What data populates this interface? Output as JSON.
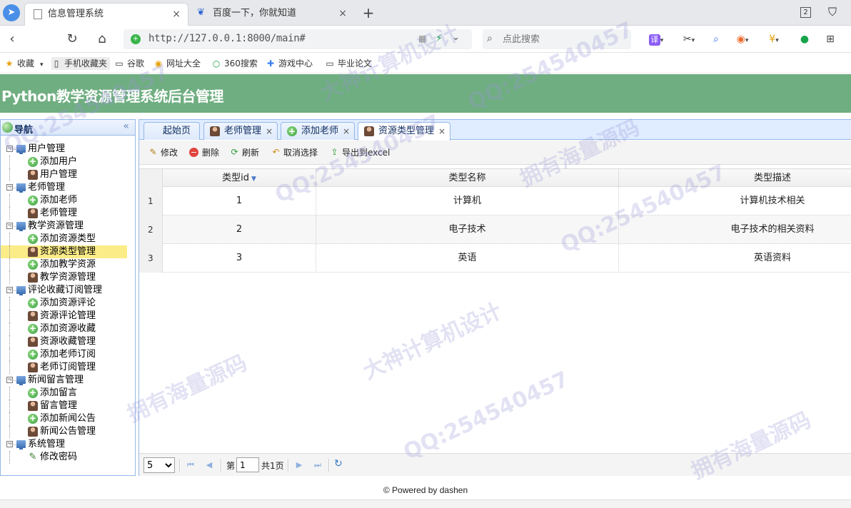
{
  "browser": {
    "tabs": [
      {
        "title": "信息管理系统",
        "close": "×"
      },
      {
        "title": "百度一下，你就知道",
        "close": "×"
      }
    ],
    "new_tab": "+",
    "window_count": "2",
    "url": "http://127.0.0.1:8000/main#",
    "search_placeholder": "点此搜索",
    "translate_label": "译",
    "bookmarks": [
      "收藏",
      "手机收藏夹",
      "谷歌",
      "网址大全",
      "360搜索",
      "游戏中心",
      "毕业论文"
    ]
  },
  "app": {
    "title": "Python教学资源管理系统后台管理"
  },
  "nav": {
    "title": "导航",
    "collapse": "«",
    "groups": [
      {
        "label": "用户管理",
        "items": [
          {
            "label": "添加用户",
            "icon": "add"
          },
          {
            "label": "用户管理",
            "icon": "user"
          }
        ]
      },
      {
        "label": "老师管理",
        "items": [
          {
            "label": "添加老师",
            "icon": "add"
          },
          {
            "label": "老师管理",
            "icon": "user"
          }
        ]
      },
      {
        "label": "教学资源管理",
        "items": [
          {
            "label": "添加资源类型",
            "icon": "add"
          },
          {
            "label": "资源类型管理",
            "icon": "user",
            "selected": true
          },
          {
            "label": "添加教学资源",
            "icon": "add"
          },
          {
            "label": "教学资源管理",
            "icon": "user"
          }
        ]
      },
      {
        "label": "评论收藏订阅管理",
        "items": [
          {
            "label": "添加资源评论",
            "icon": "add"
          },
          {
            "label": "资源评论管理",
            "icon": "user"
          },
          {
            "label": "添加资源收藏",
            "icon": "add"
          },
          {
            "label": "资源收藏管理",
            "icon": "user"
          },
          {
            "label": "添加老师订阅",
            "icon": "add"
          },
          {
            "label": "老师订阅管理",
            "icon": "user"
          }
        ]
      },
      {
        "label": "新闻留言管理",
        "items": [
          {
            "label": "添加留言",
            "icon": "add"
          },
          {
            "label": "留言管理",
            "icon": "user"
          },
          {
            "label": "添加新闻公告",
            "icon": "add"
          },
          {
            "label": "新闻公告管理",
            "icon": "user"
          }
        ]
      },
      {
        "label": "系统管理",
        "items": [
          {
            "label": "修改密码",
            "icon": "pencil"
          }
        ]
      }
    ]
  },
  "page_tabs": [
    {
      "label": "起始页"
    },
    {
      "label": "老师管理",
      "close": "×"
    },
    {
      "label": "添加老师",
      "close": "×"
    },
    {
      "label": "资源类型管理",
      "close": "×"
    }
  ],
  "toolbar": {
    "edit": "修改",
    "delete": "删除",
    "refresh": "刷新",
    "unselect": "取消选择",
    "export": "导出到excel"
  },
  "grid": {
    "columns": [
      "类型id",
      "类型名称",
      "类型描述"
    ],
    "rows": [
      {
        "n": "1",
        "id": "1",
        "name": "计算机",
        "desc": "计算机技术相关"
      },
      {
        "n": "2",
        "id": "2",
        "name": "电子技术",
        "desc": "电子技术的相关资料"
      },
      {
        "n": "3",
        "id": "3",
        "name": "英语",
        "desc": "英语资料"
      }
    ]
  },
  "pager": {
    "page_size": "5",
    "page_prefix": "第",
    "page_number": "1",
    "total_pages": "共1页"
  },
  "footer": {
    "text": "© Powered by dashen"
  },
  "watermarks": [
    "QQ:254540457",
    "大神计算机设计",
    "拥有海量源码"
  ]
}
